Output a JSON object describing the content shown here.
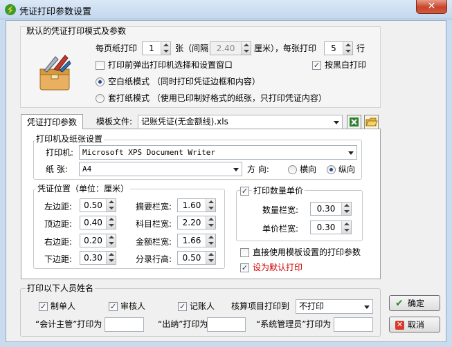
{
  "window": {
    "title": "凭证打印参数设置",
    "close_label": "✕"
  },
  "defaults_group": {
    "label": "默认的凭证打印模式及参数",
    "per_page_label": "每页纸打印",
    "per_page_value": "1",
    "unit_zhang": "张（间隔",
    "gap_value": "2.40",
    "gap_unit_label": "厘米），每张打印",
    "rows_value": "5",
    "rows_unit": "行",
    "popup_printer_label": "打印前弹出打印机选择和设置窗口",
    "popup_printer_checked": false,
    "black_white_label": "按黑白打印",
    "black_white_checked": true,
    "mode_blank_label": "空白纸模式 （同时打印凭证边框和内容）",
    "mode_blank_selected": true,
    "mode_preprinted_label": "套打纸模式 （使用已印制好格式的纸张，只打印凭证内容）",
    "mode_preprinted_selected": false
  },
  "tabs": [
    {
      "label": "凭证打印参数",
      "active": true
    }
  ],
  "template": {
    "label": "模板文件:",
    "value": "记账凭证(无金额线).xls"
  },
  "printer_group": {
    "label": "打印机及纸张设置",
    "printer_label": "打印机:",
    "printer_value": "Microsoft XPS Document Writer",
    "paper_label": "纸  张:",
    "paper_value": "A4",
    "orientation_label": "方  向:",
    "landscape_label": "横向",
    "portrait_label": "纵向",
    "orientation_selected": "纵向"
  },
  "position_group": {
    "label": "凭证位置（单位：厘米）",
    "left_margin_label": "左边距:",
    "left_margin_value": "0.50",
    "top_margin_label": "顶边距:",
    "top_margin_value": "0.40",
    "right_margin_label": "右边距:",
    "right_margin_value": "0.20",
    "bottom_margin_label": "下边距:",
    "bottom_margin_value": "0.30",
    "summary_width_label": "摘要栏宽:",
    "summary_width_value": "1.60",
    "subject_width_label": "科目栏宽:",
    "subject_width_value": "2.20",
    "amount_width_label": "金额栏宽:",
    "amount_width_value": "1.66",
    "row_height_label": "分录行高:",
    "row_height_value": "0.50"
  },
  "quantity_group": {
    "label": "打印数量单价",
    "checked": true,
    "qty_width_label": "数量栏宽:",
    "qty_width_value": "0.30",
    "price_width_label": "单价栏宽:",
    "price_width_value": "0.30"
  },
  "use_template_label": "直接使用模板设置的打印参数",
  "use_template_checked": false,
  "set_default_label": "设为默认打印",
  "set_default_checked": true,
  "signers_group": {
    "label": "打印以下人员姓名",
    "maker_label": "制单人",
    "maker_checked": true,
    "reviewer_label": "审核人",
    "reviewer_checked": true,
    "bookkeeper_label": "记账人",
    "bookkeeper_checked": true,
    "accounting_print_label": "核算项目打印到",
    "accounting_print_value": "不打印",
    "supervisor_label": "“会计主管”打印为",
    "cashier_label": "“出纳”打印为",
    "admin_label": "“系统管理员”打印为",
    "supervisor_value": "",
    "cashier_value": "",
    "admin_value": ""
  },
  "buttons": {
    "ok": "确定",
    "cancel": "取消"
  },
  "colors": {
    "accent_red": "#d00000",
    "title_bar": "#c9dcef"
  }
}
